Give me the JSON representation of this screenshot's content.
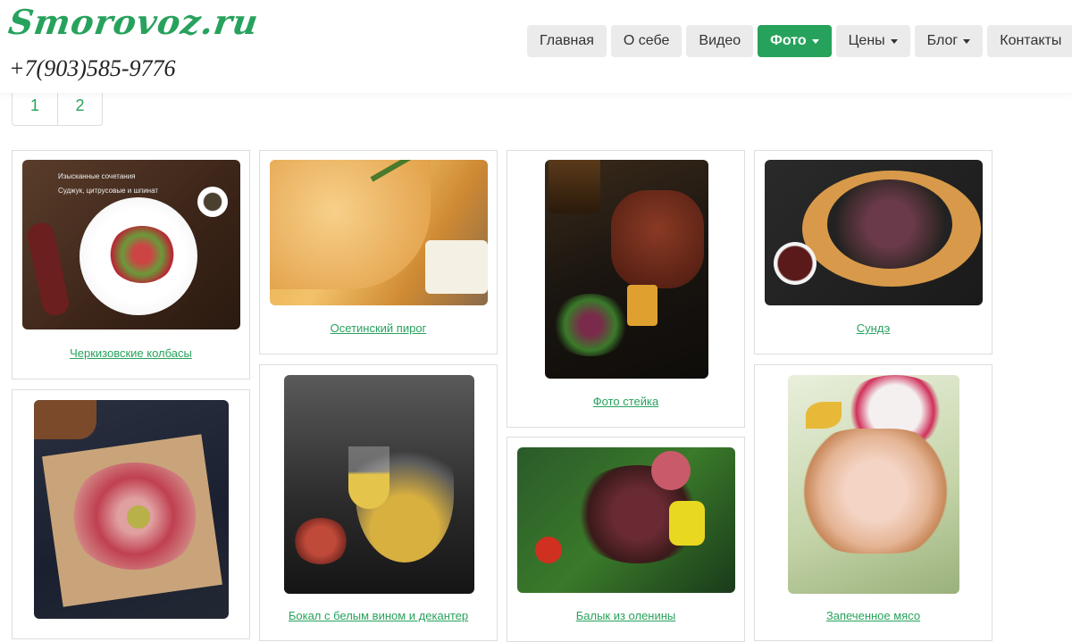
{
  "header": {
    "logo": "Smorovoz.ru",
    "phone": "+7(903)585-9776"
  },
  "nav": [
    {
      "label": "Главная"
    },
    {
      "label": "О себе"
    },
    {
      "label": "Видео"
    },
    {
      "label": "Фото"
    },
    {
      "label": "Цены"
    },
    {
      "label": "Блог"
    },
    {
      "label": "Контакты"
    }
  ],
  "pagination": [
    "1",
    "2"
  ],
  "gallery": [
    {
      "caption": "Черкизовские колбасы",
      "photo_text": [
        "Изысканные сочетания",
        "Суджук, цитрусовые и шпинат"
      ]
    },
    {
      "caption": "Осетинский пирог"
    },
    {
      "caption": "Фото стейка"
    },
    {
      "caption": "Сундэ"
    },
    {
      "caption": ""
    },
    {
      "caption": "Бокал с белым вином и декантер"
    },
    {
      "caption": "Балык из оленины"
    },
    {
      "caption": "Запеченное мясо"
    }
  ],
  "colors": {
    "accent": "#27a25c",
    "nav_bg": "#ebebeb",
    "border": "#dddddd"
  }
}
